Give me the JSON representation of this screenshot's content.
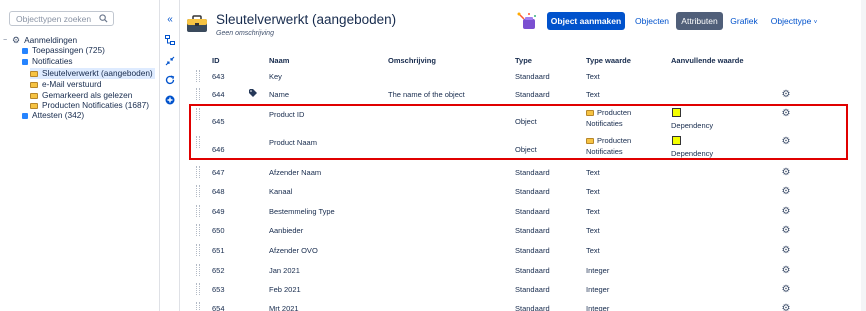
{
  "sidebar": {
    "search_placeholder": "Objecttypen zoeken",
    "tree": [
      {
        "label": "Aanmeldingen",
        "level": 0,
        "icon": "gear-icon",
        "selected": false
      },
      {
        "label": "Toepassingen (725)",
        "level": 1,
        "icon": "blue-square-icon",
        "selected": false
      },
      {
        "label": "Notificaties",
        "level": 1,
        "icon": "blue-square-icon",
        "selected": false
      },
      {
        "label": "Sleutelverwerkt (aangeboden)",
        "level": 2,
        "icon": "briefcase-icon",
        "selected": true
      },
      {
        "label": "e-Mail verstuurd",
        "level": 2,
        "icon": "briefcase-icon",
        "selected": false
      },
      {
        "label": "Gemarkeerd als gelezen",
        "level": 2,
        "icon": "briefcase-icon",
        "selected": false
      },
      {
        "label": "Producten Notificaties (1687)",
        "level": 2,
        "icon": "briefcase-icon",
        "selected": false
      },
      {
        "label": "Attesten (342)",
        "level": 1,
        "icon": "blue-square-icon",
        "selected": false
      }
    ]
  },
  "strip_icons": [
    "collapse-left-icon",
    "hierarchy-icon",
    "compress-icon",
    "refresh-icon",
    "add-circle-icon"
  ],
  "header": {
    "title": "Sleutelverwerkt (aangeboden)",
    "subtitle": "Geen omschrijving",
    "create_button": "Object aanmaken",
    "nav_objects": "Objecten",
    "nav_attributes": "Attributen",
    "nav_graph": "Grafiek",
    "nav_objecttype": "Objecttype"
  },
  "table": {
    "headers": {
      "id": "ID",
      "name": "Naam",
      "description": "Omschrijving",
      "type": "Type",
      "type_value": "Type waarde",
      "extra_value": "Aanvullende waarde"
    },
    "rows": [
      {
        "id": "643",
        "name": "Key",
        "description": "",
        "type": "Standaard",
        "type_value": "Text",
        "type_value_2": "",
        "extra": "",
        "gear": false,
        "tag": false,
        "ref_icon": false,
        "yellow": false
      },
      {
        "id": "644",
        "name": "Name",
        "description": "The name of the object",
        "type": "Standaard",
        "type_value": "Text",
        "type_value_2": "",
        "extra": "",
        "gear": true,
        "tag": true,
        "ref_icon": false,
        "yellow": false
      },
      {
        "id": "645",
        "name": "Product ID",
        "description": "",
        "type": "Object",
        "type_value": "Producten",
        "type_value_2": "Notificaties",
        "extra": "Dependency",
        "gear": true,
        "tag": false,
        "ref_icon": true,
        "yellow": true
      },
      {
        "id": "646",
        "name": "Product Naam",
        "description": "",
        "type": "Object",
        "type_value": "Producten",
        "type_value_2": "Notificaties",
        "extra": "Dependency",
        "gear": true,
        "tag": false,
        "ref_icon": true,
        "yellow": true
      },
      {
        "id": "647",
        "name": "Afzender Naam",
        "description": "",
        "type": "Standaard",
        "type_value": "Text",
        "type_value_2": "",
        "extra": "",
        "gear": true,
        "tag": false,
        "ref_icon": false,
        "yellow": false
      },
      {
        "id": "648",
        "name": "Kanaal",
        "description": "",
        "type": "Standaard",
        "type_value": "Text",
        "type_value_2": "",
        "extra": "",
        "gear": true,
        "tag": false,
        "ref_icon": false,
        "yellow": false
      },
      {
        "id": "649",
        "name": "Bestemmeling Type",
        "description": "",
        "type": "Standaard",
        "type_value": "Text",
        "type_value_2": "",
        "extra": "",
        "gear": true,
        "tag": false,
        "ref_icon": false,
        "yellow": false
      },
      {
        "id": "650",
        "name": "Aanbieder",
        "description": "",
        "type": "Standaard",
        "type_value": "Text",
        "type_value_2": "",
        "extra": "",
        "gear": true,
        "tag": false,
        "ref_icon": false,
        "yellow": false
      },
      {
        "id": "651",
        "name": "Afzender OVO",
        "description": "",
        "type": "Standaard",
        "type_value": "Text",
        "type_value_2": "",
        "extra": "",
        "gear": true,
        "tag": false,
        "ref_icon": false,
        "yellow": false
      },
      {
        "id": "652",
        "name": "Jan 2021",
        "description": "",
        "type": "Standaard",
        "type_value": "Integer",
        "type_value_2": "",
        "extra": "",
        "gear": true,
        "tag": false,
        "ref_icon": false,
        "yellow": false
      },
      {
        "id": "653",
        "name": "Feb 2021",
        "description": "",
        "type": "Standaard",
        "type_value": "Integer",
        "type_value_2": "",
        "extra": "",
        "gear": true,
        "tag": false,
        "ref_icon": false,
        "yellow": false
      },
      {
        "id": "654",
        "name": "Mrt 2021",
        "description": "",
        "type": "Standaard",
        "type_value": "Integer",
        "type_value_2": "",
        "extra": "",
        "gear": true,
        "tag": false,
        "ref_icon": false,
        "yellow": false
      }
    ]
  },
  "colors": {
    "primary": "#0052cc",
    "active_nav": "#505f79",
    "highlight_border": "#e00000",
    "selected_tree": "#deebff",
    "dependency_yellow": "#f4ff00"
  }
}
